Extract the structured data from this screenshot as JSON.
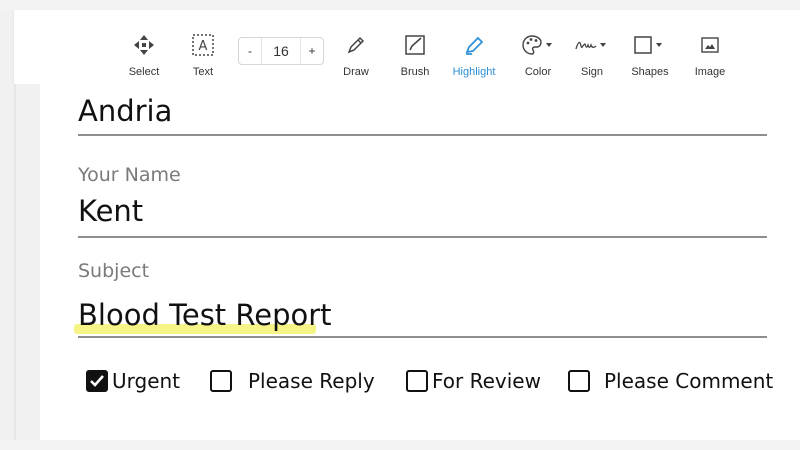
{
  "toolbar": {
    "tools": [
      {
        "label": "Select",
        "icon": "move-arrows-icon"
      },
      {
        "label": "Text",
        "icon": "text-box-icon"
      },
      {
        "label": "Draw",
        "icon": "pencil-icon"
      },
      {
        "label": "Brush",
        "icon": "brush-icon"
      },
      {
        "label": "Highlight",
        "icon": "highlighter-icon",
        "active": true
      },
      {
        "label": "Color",
        "icon": "palette-icon"
      },
      {
        "label": "Sign",
        "icon": "signature-icon"
      },
      {
        "label": "Shapes",
        "icon": "square-shape-icon"
      },
      {
        "label": "Image",
        "icon": "image-icon"
      }
    ],
    "font_size": {
      "decrement": "-",
      "value": "16",
      "increment": "+"
    },
    "accent_color": "#2a8fd6"
  },
  "form": {
    "recipient_value": "Andria",
    "your_name_label": "Your Name",
    "your_name_value": "Kent",
    "subject_label": "Subject",
    "subject_value": "Blood Test Report",
    "highlight_color": "#f5f37a",
    "checkboxes": [
      {
        "label": "Urgent",
        "checked": true
      },
      {
        "label": "Please Reply",
        "checked": false
      },
      {
        "label": "For Review",
        "checked": false
      },
      {
        "label": "Please Comment",
        "checked": false
      }
    ]
  }
}
